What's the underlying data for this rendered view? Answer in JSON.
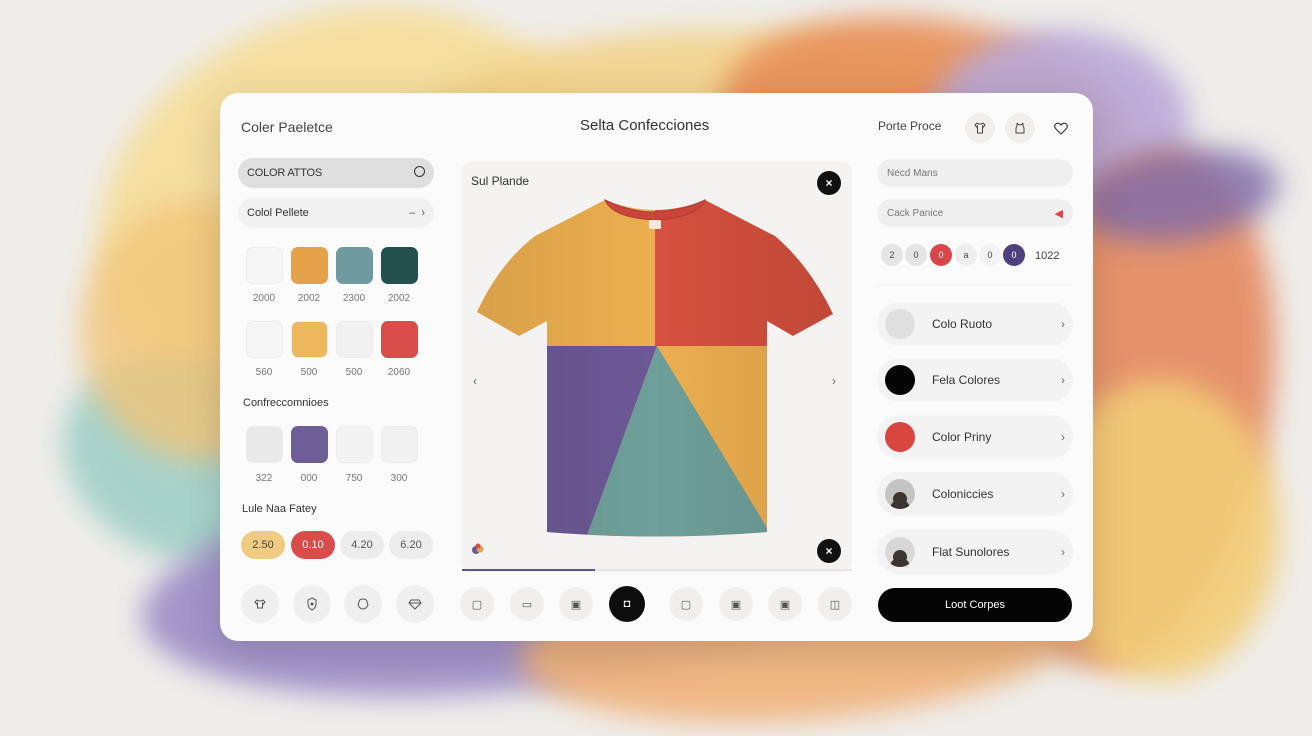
{
  "header": {
    "left_title": "Coler Paeletce",
    "center_title": "Selta Confecciones",
    "right_label": "Porte Proce",
    "icons": [
      "shirt-icon",
      "tank-top-icon",
      "heart-icon"
    ]
  },
  "left_panel": {
    "dropdown_label": "COLOR ATTOS",
    "palette_label": "Colol Pellete",
    "palette_right": "–",
    "swatches_row1": [
      {
        "color": "#f6f6f6",
        "label": "2000"
      },
      {
        "color": "#e6a24b",
        "label": "2002"
      },
      {
        "color": "#6f9a9f",
        "label": "2300"
      },
      {
        "color": "#23524e",
        "label": "2002"
      }
    ],
    "swatches_row2": [
      {
        "color": "#f6f6f6",
        "label": "560"
      },
      {
        "color": "#eeb75e",
        "label": "500"
      },
      {
        "color": "#f1f1f1",
        "label": "500"
      },
      {
        "color": "#d94c4a",
        "label": "2060"
      }
    ],
    "section_label": "Confreccomnioes",
    "swatches_row3": [
      {
        "color": "#e9e9e9",
        "label": "322"
      },
      {
        "color": "#6d5e97",
        "label": "000"
      },
      {
        "color": "#f3f3f3",
        "label": "750"
      },
      {
        "color": "#f1f1f1",
        "label": "300"
      }
    ],
    "tags_label": "Lule Naa Fatey",
    "tags": [
      {
        "label": "2.50",
        "bg": "#f0cc83",
        "fg": "#444"
      },
      {
        "label": "0.10",
        "bg": "#d94c4a",
        "fg": "#ffffff"
      },
      {
        "label": "4.20",
        "bg": "#ececec",
        "fg": "#555"
      },
      {
        "label": "6.20",
        "bg": "#ececec",
        "fg": "#555"
      }
    ],
    "bottom_icons": [
      "shirt-outline-icon",
      "shield-icon",
      "face-icon",
      "diamond-icon"
    ]
  },
  "center": {
    "stage_title": "Sul Plande",
    "close_glyph": "×",
    "prev_glyph": "‹",
    "next_glyph": "›",
    "progress": 0.34,
    "tshirt_colors": {
      "top_left": "#ecae4f",
      "top_right": "#d6503e",
      "collar": "#c9453a",
      "bottom_left": "#6b5895",
      "bottom_center": "#6f9f9a",
      "bottom_right": "#ecae4f"
    },
    "toolbar_icons": [
      "tool-1-icon",
      "tool-2-icon",
      "tool-3-icon",
      "tool-active-icon",
      "tool-5-icon",
      "tool-6-icon",
      "tool-7-icon",
      "tool-8-icon"
    ],
    "active_tool_index": 3
  },
  "right_panel": {
    "field1": "Necd Mans",
    "field2": "Cack Panice",
    "chips": [
      {
        "label": "2",
        "bg": "#e6e5e5",
        "fg": "#444"
      },
      {
        "label": "0",
        "bg": "#e6e5e5",
        "fg": "#444"
      },
      {
        "label": "0",
        "bg": "#d8464a",
        "fg": "#fff"
      },
      {
        "label": "a",
        "bg": "#eeeeee",
        "fg": "#444"
      },
      {
        "label": "0",
        "bg": "#f3f3f3",
        "fg": "#444"
      },
      {
        "label": "0",
        "bg": "#4f407e",
        "fg": "#fff"
      }
    ],
    "chip_count": "1022",
    "rows": [
      {
        "label": "Colo Ruoto",
        "dot": "#dedede",
        "type": "color"
      },
      {
        "label": "Fela Colores",
        "dot": "#050505",
        "type": "color"
      },
      {
        "label": "Color Priny",
        "dot": "#d9453f",
        "type": "color"
      },
      {
        "label": "Coloniccies",
        "dot": "#c4c4c4",
        "type": "avatar"
      },
      {
        "label": "Flat Sunolores",
        "dot": "#d8d8d8",
        "type": "avatar"
      }
    ],
    "cta_label": "Loot Corpes"
  }
}
